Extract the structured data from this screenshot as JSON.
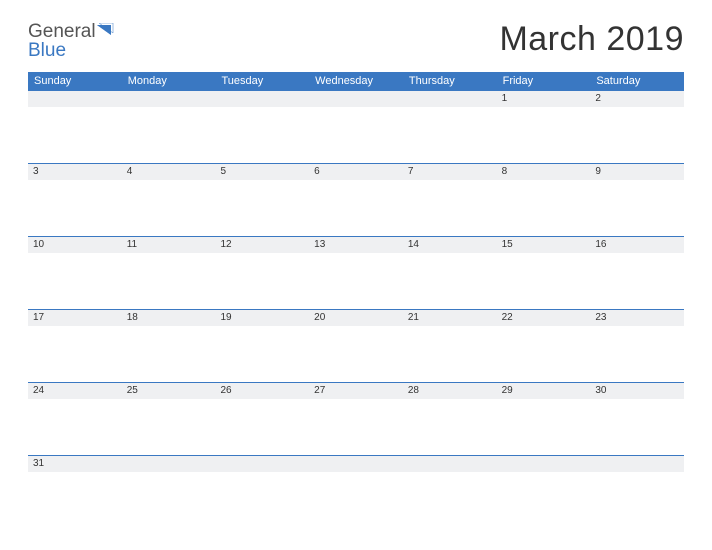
{
  "brand": {
    "word1": "General",
    "word2": "Blue"
  },
  "title": "March 2019",
  "dayHeaders": [
    "Sunday",
    "Monday",
    "Tuesday",
    "Wednesday",
    "Thursday",
    "Friday",
    "Saturday"
  ],
  "weeks": [
    [
      "",
      "",
      "",
      "",
      "",
      "1",
      "2"
    ],
    [
      "3",
      "4",
      "5",
      "6",
      "7",
      "8",
      "9"
    ],
    [
      "10",
      "11",
      "12",
      "13",
      "14",
      "15",
      "16"
    ],
    [
      "17",
      "18",
      "19",
      "20",
      "21",
      "22",
      "23"
    ],
    [
      "24",
      "25",
      "26",
      "27",
      "28",
      "29",
      "30"
    ],
    [
      "31",
      "",
      "",
      "",
      "",
      "",
      ""
    ]
  ]
}
